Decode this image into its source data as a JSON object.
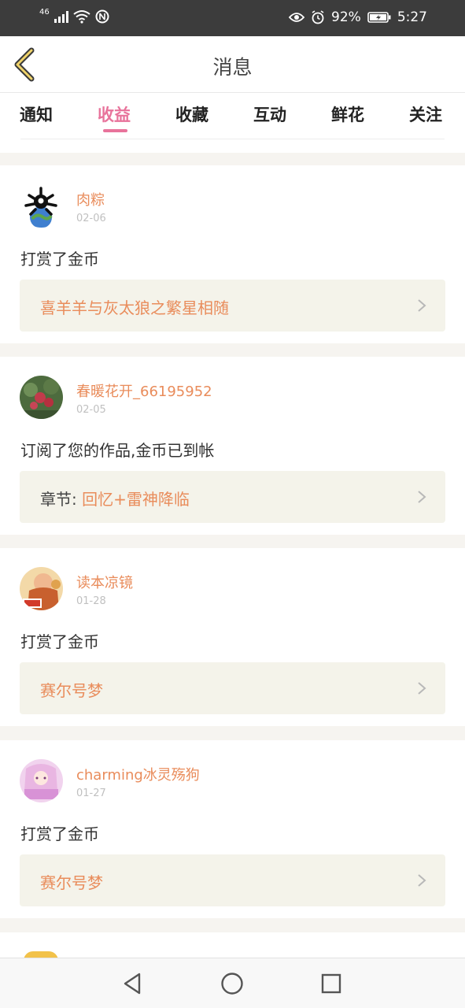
{
  "status_bar": {
    "network": "46",
    "battery": "92%",
    "time": "5:27"
  },
  "header": {
    "title": "消息"
  },
  "tabs": [
    {
      "label": "通知",
      "active": false
    },
    {
      "label": "收益",
      "active": true
    },
    {
      "label": "收藏",
      "active": false
    },
    {
      "label": "互动",
      "active": false
    },
    {
      "label": "鲜花",
      "active": false
    },
    {
      "label": "关注",
      "active": false
    }
  ],
  "messages": [
    {
      "username": "肉粽",
      "date": "02-06",
      "action": "打赏了金币",
      "item_prefix": "",
      "item_title": "喜羊羊与灰太狼之繁星相随"
    },
    {
      "username": "春暖花开_66195952",
      "date": "02-05",
      "action": "订阅了您的作品,金币已到帐",
      "item_prefix": "章节:",
      "item_title": "回忆+雷神降临"
    },
    {
      "username": "读本凉镜",
      "date": "01-28",
      "action": "打赏了金币",
      "item_prefix": "",
      "item_title": "赛尔号梦"
    },
    {
      "username": "charming冰灵殇狗",
      "date": "01-27",
      "action": "打赏了金币",
      "item_prefix": "",
      "item_title": "赛尔号梦"
    }
  ],
  "colors": {
    "accent": "#e8739b",
    "username": "#e98c5b",
    "item_bg": "#f4f3ea"
  }
}
